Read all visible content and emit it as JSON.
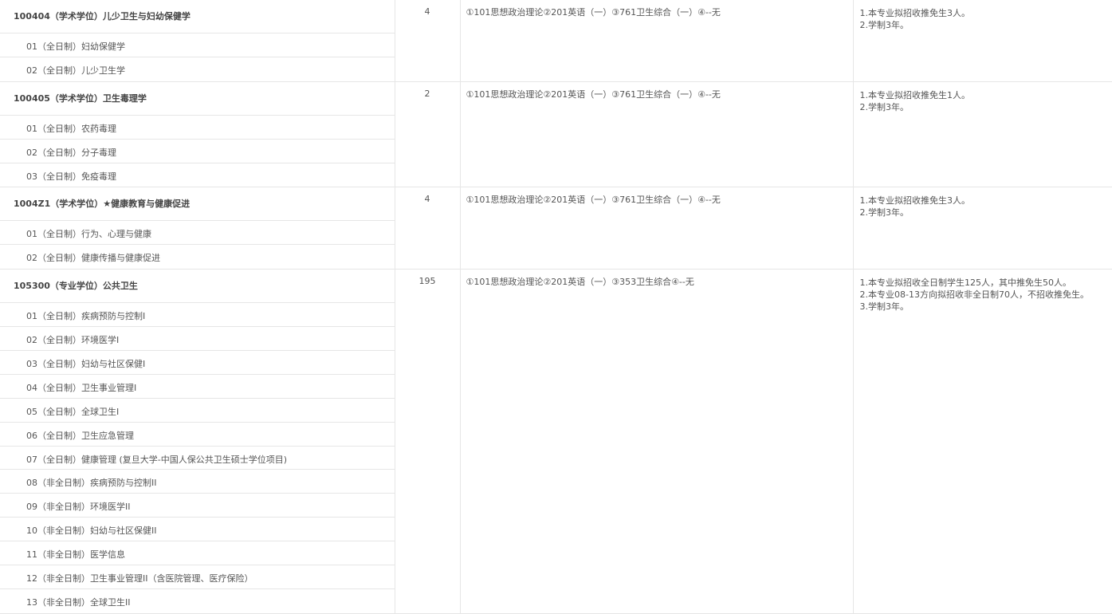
{
  "majors": [
    {
      "title": "100404（学术学位）儿少卫生与妇幼保健学",
      "count": "4",
      "exams": "①101思想政治理论②201英语（一）③761卫生综合（一）④--无",
      "notes": [
        "1.本专业拟招收推免生3人。",
        "2.学制3年。"
      ],
      "directions": [
        "01（全日制）妇幼保健学",
        "02（全日制）儿少卫生学"
      ]
    },
    {
      "title": "100405（学术学位）卫生毒理学",
      "count": "2",
      "exams": "①101思想政治理论②201英语（一）③761卫生综合（一）④--无",
      "notes": [
        "1.本专业拟招收推免生1人。",
        "2.学制3年。"
      ],
      "directions": [
        "01（全日制）农药毒理",
        "02（全日制）分子毒理",
        "03（全日制）免疫毒理"
      ]
    },
    {
      "title": "1004Z1（学术学位）★健康教育与健康促进",
      "count": "4",
      "exams": "①101思想政治理论②201英语（一）③761卫生综合（一）④--无",
      "notes": [
        "1.本专业拟招收推免生3人。",
        "2.学制3年。"
      ],
      "directions": [
        "01（全日制）行为、心理与健康",
        "02（全日制）健康传播与健康促进"
      ]
    },
    {
      "title": "105300（专业学位）公共卫生",
      "count": "195",
      "exams": "①101思想政治理论②201英语（一）③353卫生综合④--无",
      "notes": [
        "1.本专业拟招收全日制学生125人，其中推免生50人。",
        "2.本专业08-13方向拟招收非全日制70人，不招收推免生。",
        "3.学制3年。"
      ],
      "directions": [
        "01（全日制）疾病预防与控制I",
        "02（全日制）环境医学I",
        "03（全日制）妇幼与社区保健I",
        "04（全日制）卫生事业管理I",
        "05（全日制）全球卫生I",
        "06（全日制）卫生应急管理",
        "07（全日制）健康管理 (复旦大学-中国人保公共卫生硕士学位项目)",
        "08（非全日制）疾病预防与控制II",
        "09（非全日制）环境医学II",
        "10（非全日制）妇幼与社区保健II",
        "11（非全日制）医学信息",
        "12（非全日制）卫生事业管理II（含医院管理、医疗保险）",
        "13（非全日制）全球卫生II"
      ]
    }
  ]
}
